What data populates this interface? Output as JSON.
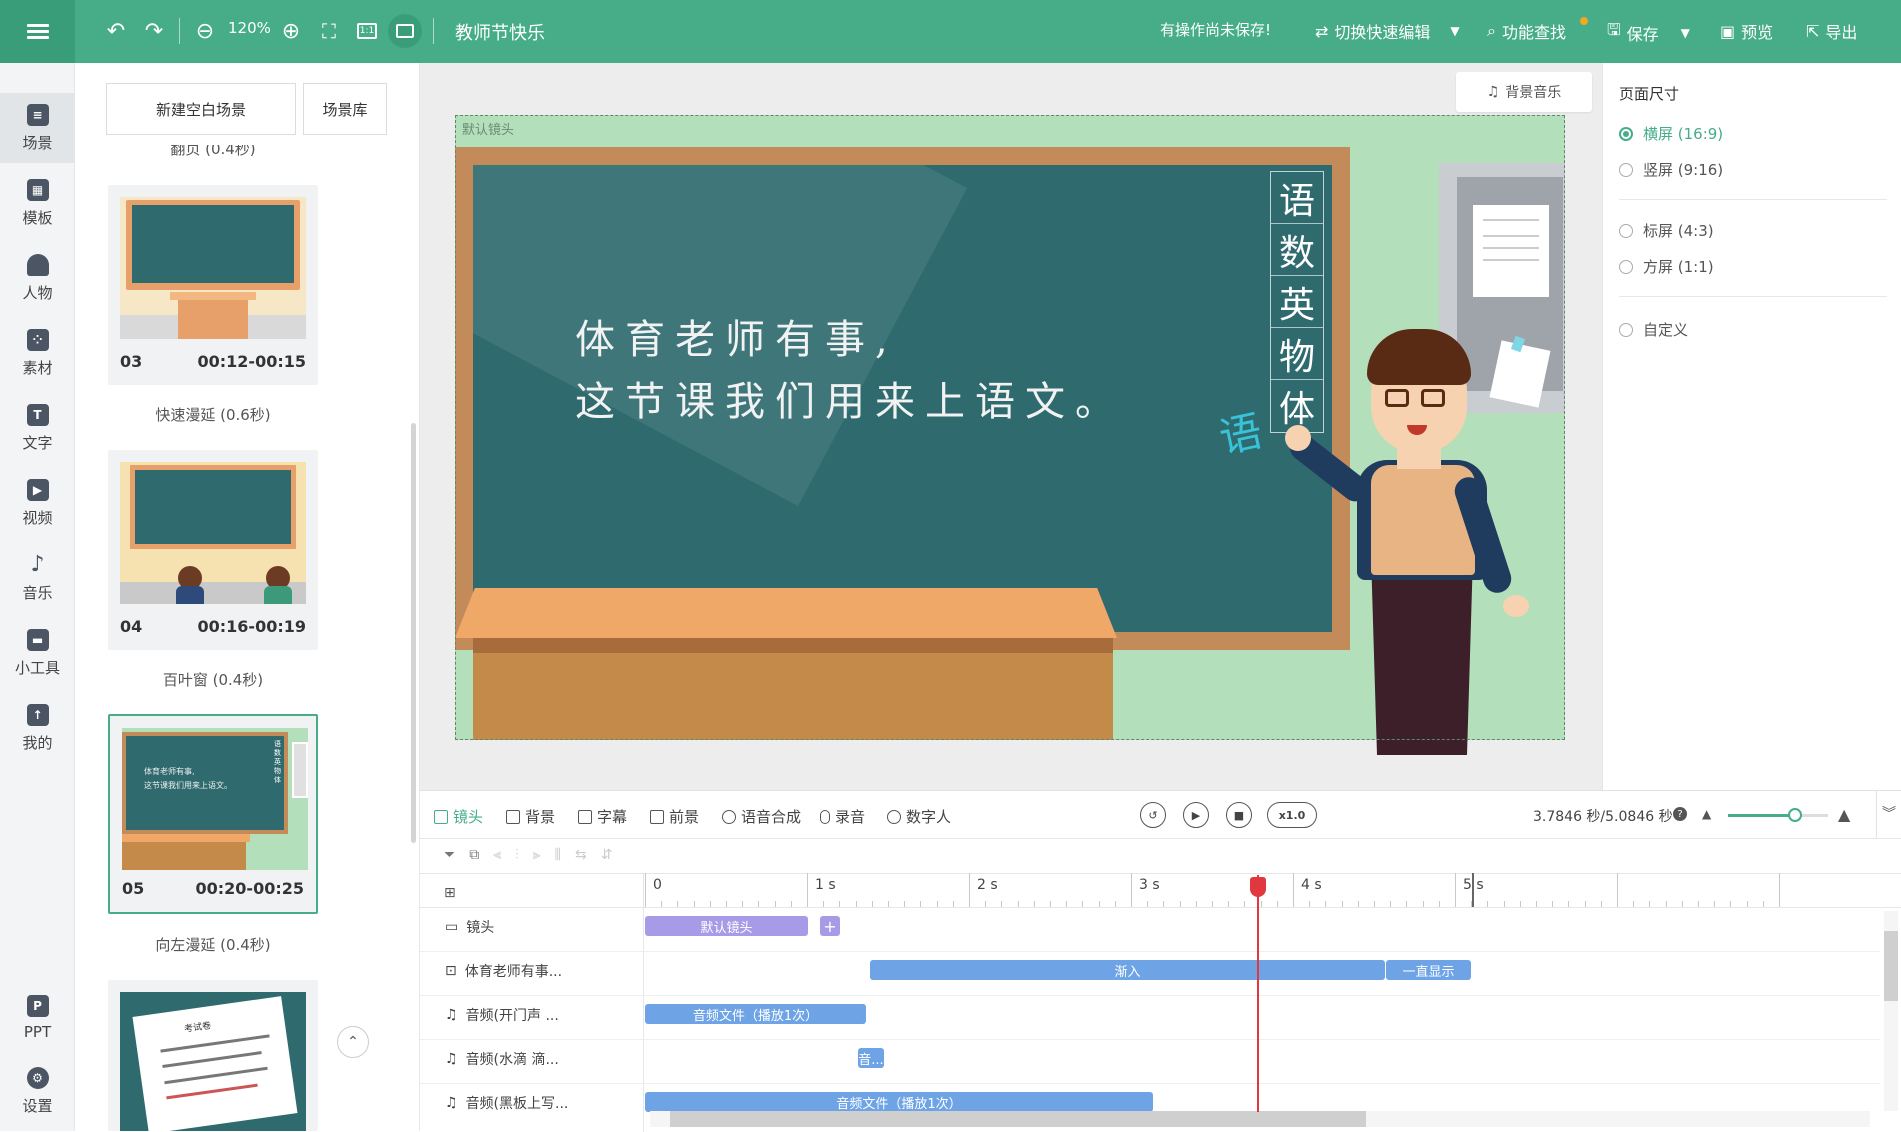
{
  "topbar": {
    "zoom": "120%",
    "title": "教师节快乐",
    "unsaved_notice": "有操作尚未保存!",
    "quick_edit": "切换快速编辑",
    "feature_search": "功能查找",
    "save": "保存",
    "preview": "预览",
    "export": "导出"
  },
  "sidebar": {
    "items": [
      {
        "label": "场景",
        "icon": "scene-icon"
      },
      {
        "label": "模板",
        "icon": "template-icon"
      },
      {
        "label": "人物",
        "icon": "person-icon"
      },
      {
        "label": "素材",
        "icon": "material-icon"
      },
      {
        "label": "文字",
        "icon": "text-icon"
      },
      {
        "label": "视频",
        "icon": "video-icon"
      },
      {
        "label": "音乐",
        "icon": "music-icon"
      },
      {
        "label": "小工具",
        "icon": "toolbox-icon"
      },
      {
        "label": "我的",
        "icon": "upload-icon"
      },
      {
        "label": "PPT",
        "icon": "ppt-icon"
      },
      {
        "label": "设置",
        "icon": "gear-icon"
      }
    ]
  },
  "scenes": {
    "new_blank": "新建空白场景",
    "library": "场景库",
    "top_transition": "翻页 (0.4秒)",
    "cards": [
      {
        "num": "03",
        "time": "00:12-00:15",
        "transition": "快速漫延 (0.6秒)"
      },
      {
        "num": "04",
        "time": "00:16-00:19",
        "transition": "百叶窗 (0.4秒)"
      },
      {
        "num": "05",
        "time": "00:20-00:25",
        "transition": "向左漫延 (0.4秒)"
      }
    ],
    "thumb_texts": {
      "card05_line1": "体育老师有事,",
      "card05_line2": "这节课我们用来上语文。",
      "card05_subjects": "语数英物体",
      "card06_title": "考试卷"
    }
  },
  "canvas": {
    "camera_label": "默认镜头",
    "bg_music": "背景音乐",
    "board_line1": "体育老师有事,",
    "board_line2": "这节课我们用来上语文。",
    "subjects": [
      "语",
      "数",
      "英",
      "物",
      "体"
    ],
    "floating_char": "语"
  },
  "page_size": {
    "title": "页面尺寸",
    "options": [
      {
        "label": "横屏 (16:9)",
        "selected": true
      },
      {
        "label": "竖屏 (9:16)",
        "selected": false
      },
      {
        "label": "标屏 (4:3)",
        "selected": false
      },
      {
        "label": "方屏 (1:1)",
        "selected": false
      },
      {
        "label": "自定义",
        "selected": false
      }
    ]
  },
  "timeline": {
    "tabs": [
      "镜头",
      "背景",
      "字幕",
      "前景",
      "语音合成",
      "录音",
      "数字人"
    ],
    "speed": "x1.0",
    "time_display": "3.7846 秒/5.0846 秒",
    "ruler": [
      "0",
      "1 s",
      "2 s",
      "3 s",
      "4 s",
      "5 s"
    ],
    "playhead_seconds": 3.7846,
    "tracks": [
      {
        "label": "镜头",
        "icon": "camera-icon"
      },
      {
        "label": "体育老师有事...",
        "icon": "text-track-icon"
      },
      {
        "label": "音频(开门声 ...",
        "icon": "music-note-icon"
      },
      {
        "label": "音频(水滴 滴...",
        "icon": "music-note-icon"
      },
      {
        "label": "音频(黑板上写...",
        "icon": "music-note-icon"
      }
    ],
    "bars": {
      "camera": "默认镜头",
      "fade_in": "渐入",
      "always_show": "一直显示",
      "audio1": "音频文件（播放1次）",
      "audio2": "音...",
      "audio3": "音频文件（播放1次）"
    }
  },
  "colors": {
    "brand": "#46ad88",
    "bar_blue": "#6ea4e6",
    "camera_bar": "#a79be8",
    "playhead": "#e0383e"
  }
}
